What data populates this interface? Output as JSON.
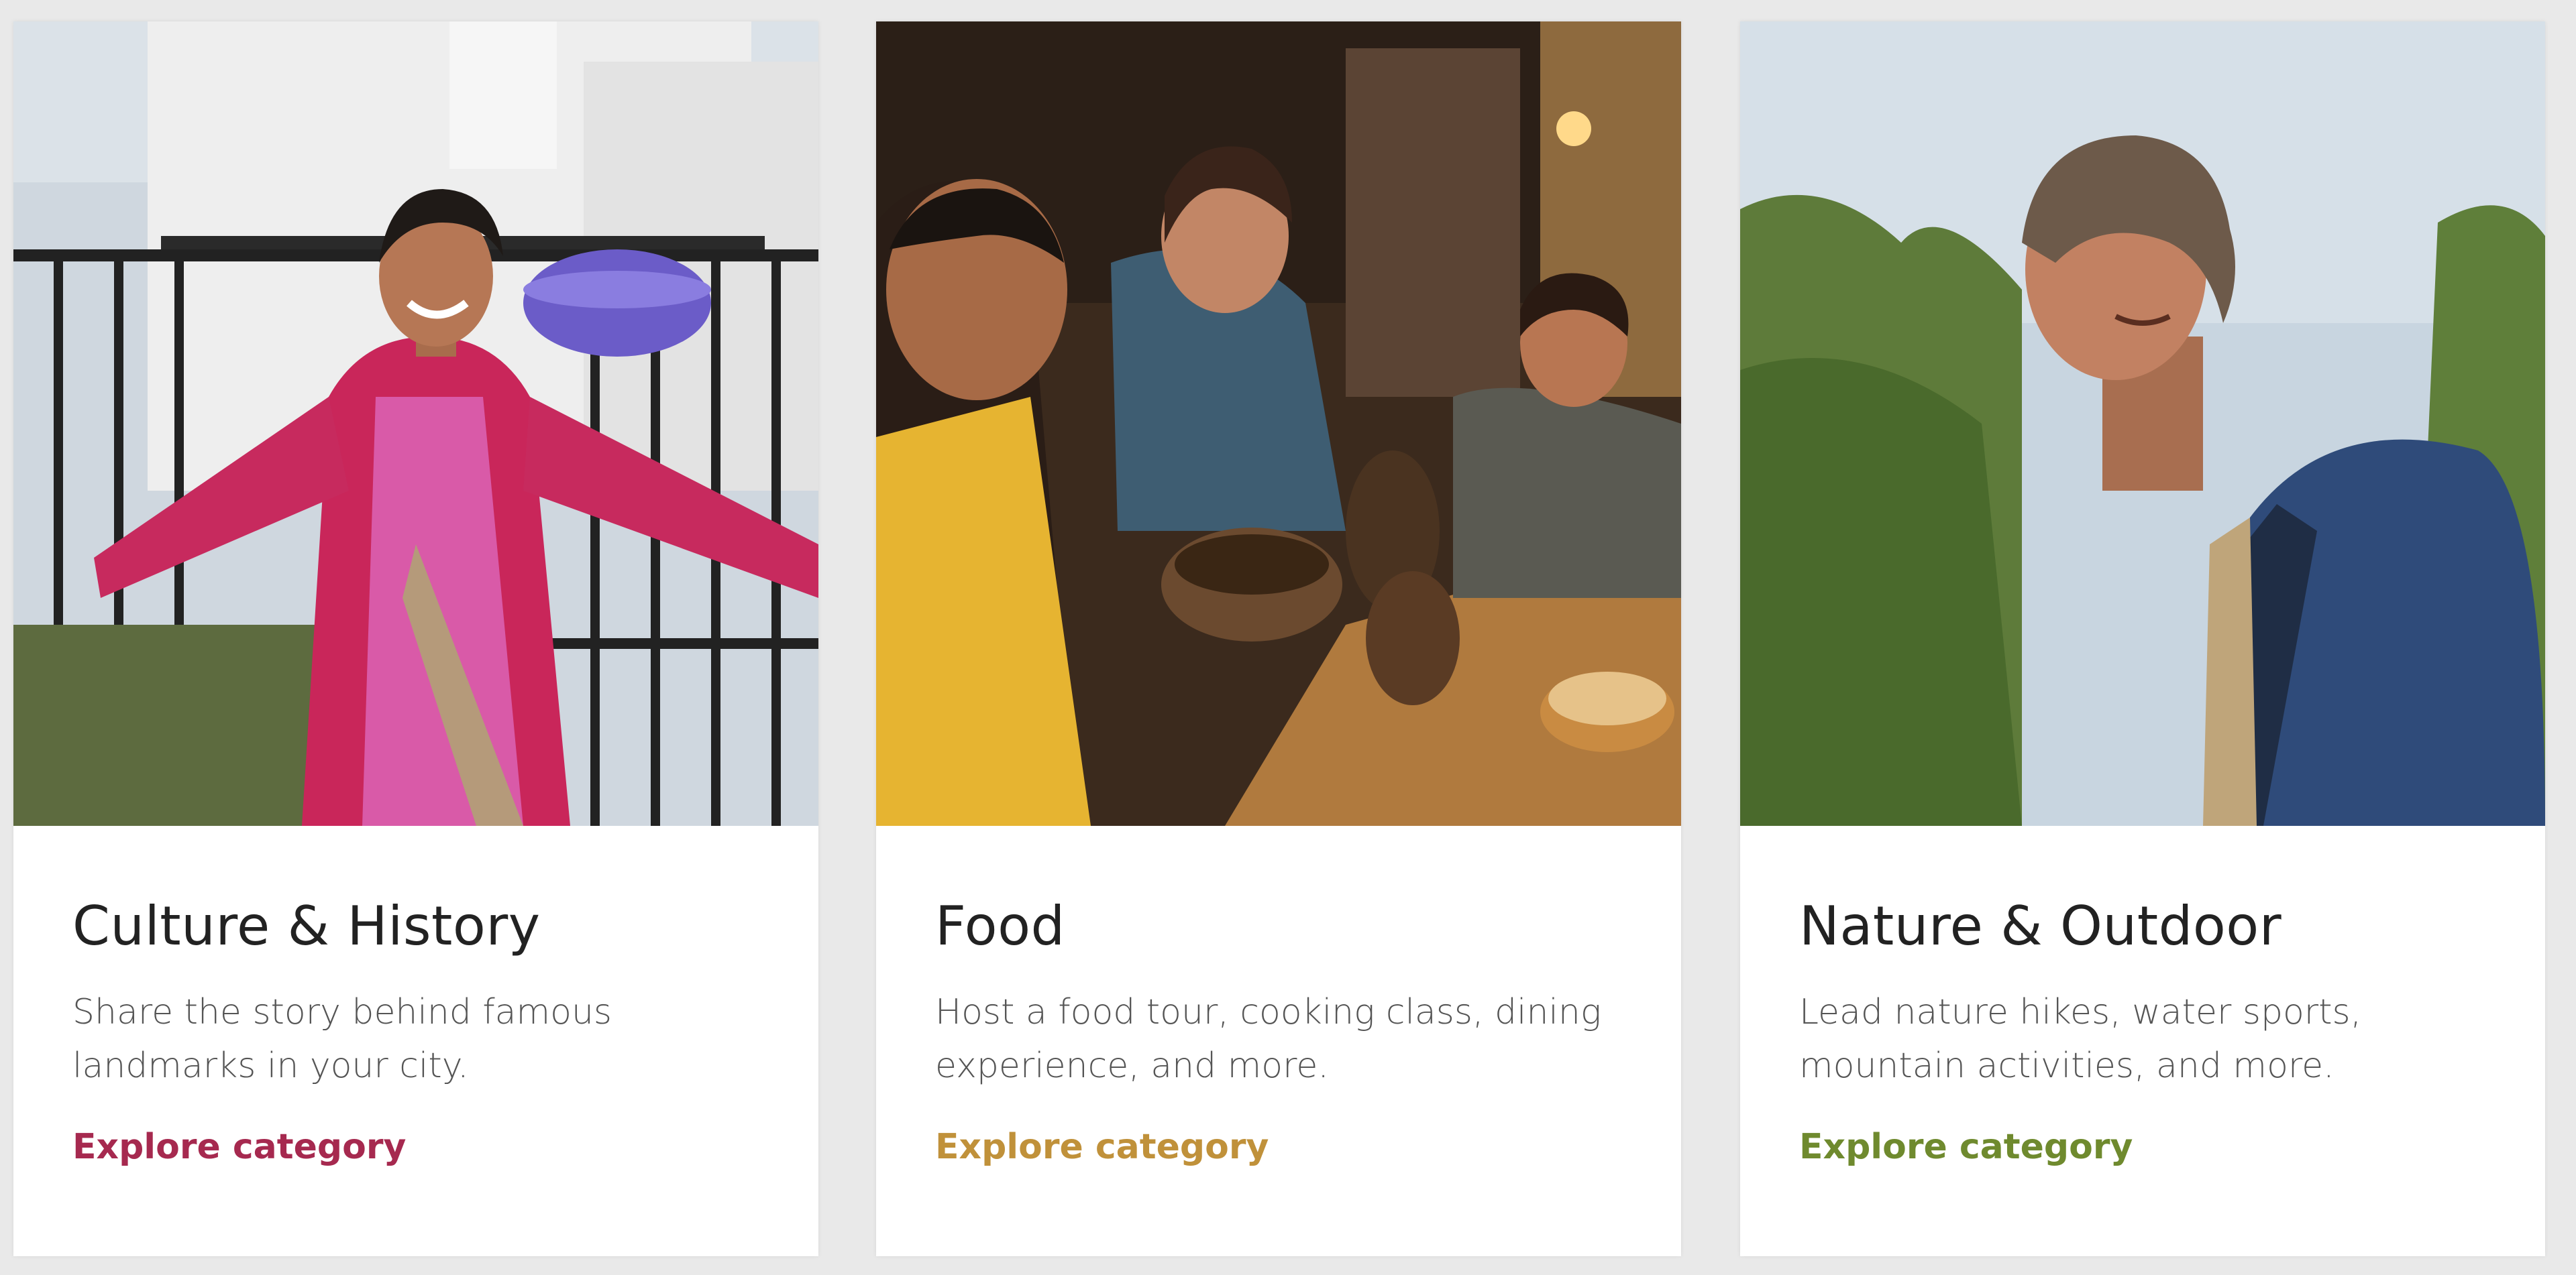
{
  "cards": [
    {
      "title": "Culture & History",
      "description": "Share the story behind famous landmarks in your city.",
      "link": "Explore category",
      "accent": "#a6294f"
    },
    {
      "title": "Food",
      "description": "Host a food tour, cooking class, dining experience, and more.",
      "link": "Explore category",
      "accent": "#c0913a"
    },
    {
      "title": "Nature & Outdoor",
      "description": "Lead nature hikes, water sports, mountain activities, and more.",
      "link": "Explore category",
      "accent": "#6f8a2e"
    }
  ]
}
